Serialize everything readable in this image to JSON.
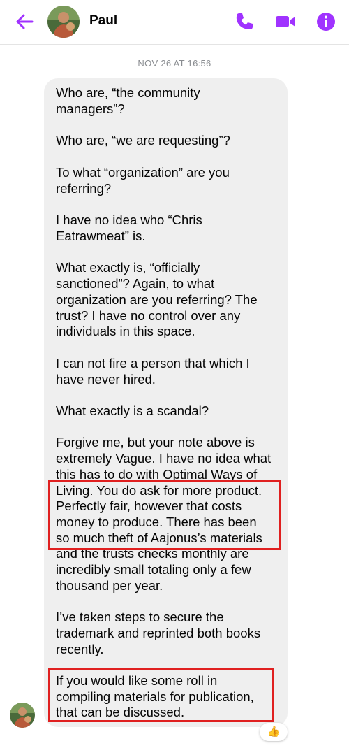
{
  "header": {
    "contact_name": "Paul",
    "accent_color": "#a033ff"
  },
  "conversation": {
    "timestamp": "NOV 26 AT 16:56",
    "message_lines": [
      "Who are, “the community",
      "managers”?",
      "Who are, “we are requesting”?",
      "To what “organization” are you",
      "referring?",
      "I have no idea who “Chris",
      "Eatrawmeat” is.",
      "What exactly is, “officially",
      "sanctioned”? Again, to what",
      "organization are you referring? The",
      "trust? I have no control over any",
      "individuals in this space.",
      "I can not fire a person that which I",
      "have never hired.",
      "What exactly is a scandal?",
      "Forgive me, but your note above is",
      "extremely Vague. I have no idea what",
      "this has to do with Optimal Ways of",
      "Living. You do ask for more product.",
      "Perfectly fair, however that costs",
      "money to produce. There has been",
      "so much theft of Aajonus’s materials",
      "and the trusts checks monthly are",
      "incredibly small totaling only a few",
      "thousand per year.",
      "I’ve taken steps to secure the",
      "trademark and reprinted both books",
      "recently.",
      "If you would like some roll in",
      "compiling materials for publication,",
      "that can be discussed."
    ],
    "reaction": "👍",
    "highlight_color": "#e02020"
  }
}
